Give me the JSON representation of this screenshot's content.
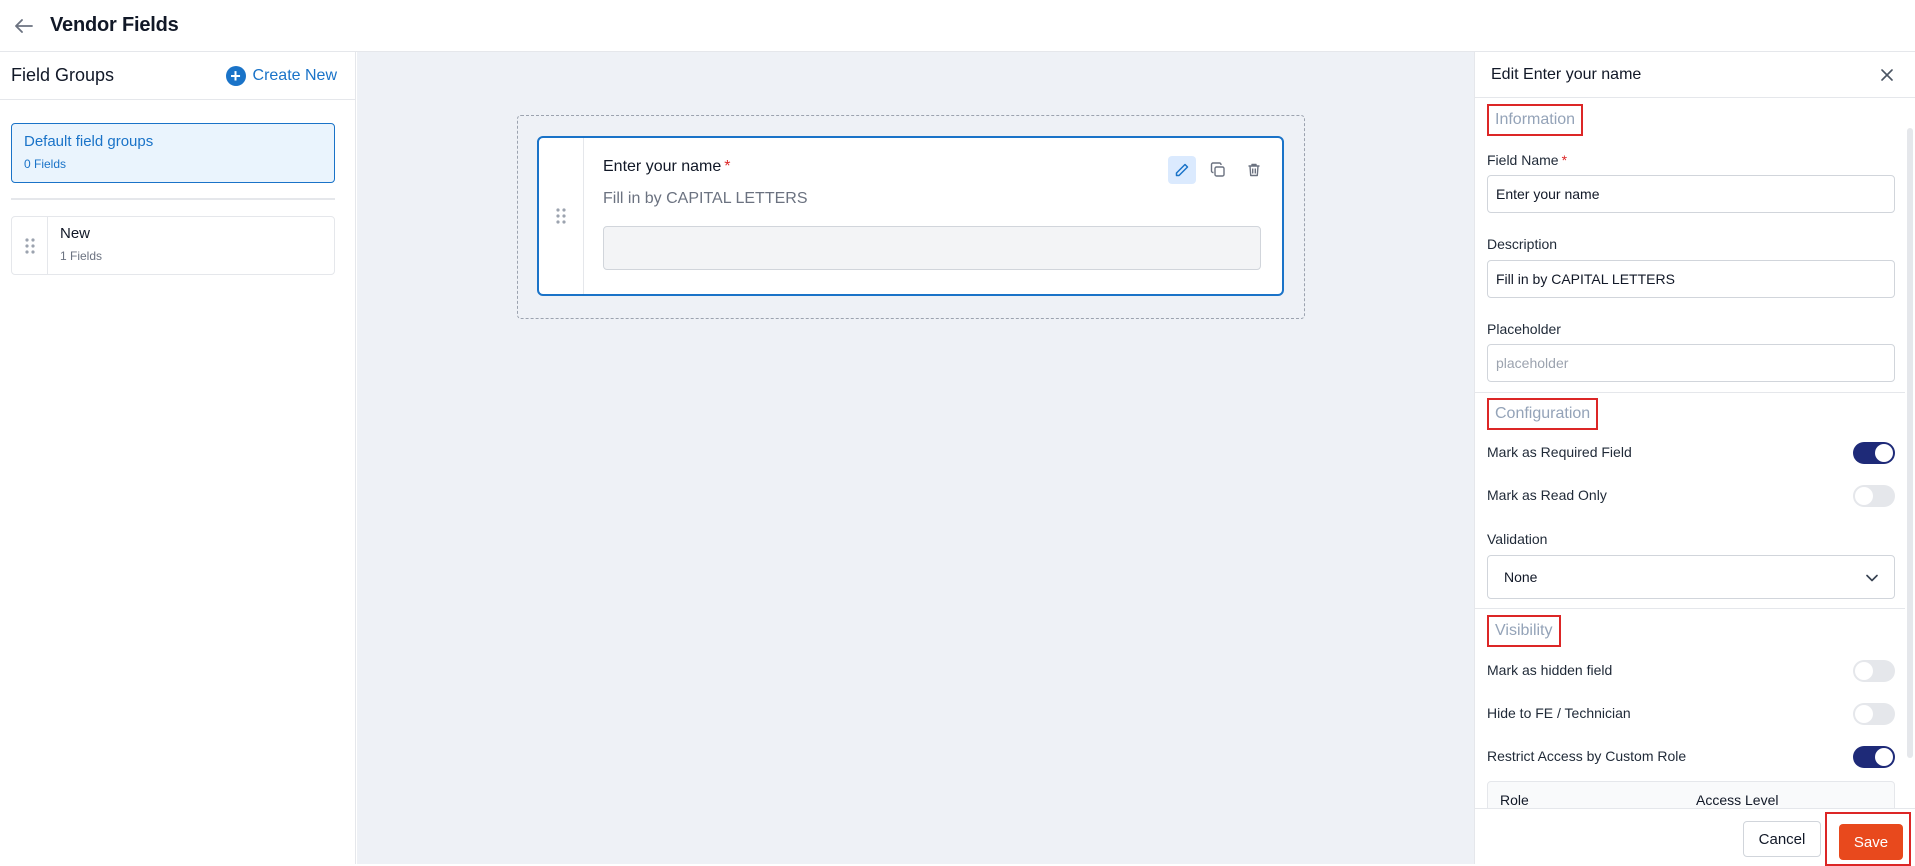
{
  "header": {
    "title": "Vendor Fields",
    "back_icon": "arrow-left-icon"
  },
  "sidebar": {
    "title": "Field Groups",
    "create_new_label": "Create New",
    "groups": [
      {
        "name": "Default field groups",
        "count": "0 Fields",
        "selected": true
      },
      {
        "name": "New",
        "count": "1 Fields",
        "selected": false
      }
    ]
  },
  "canvas": {
    "field": {
      "label": "Enter your name",
      "required_marker": "*",
      "description": "Fill in by CAPITAL LETTERS",
      "actions": [
        "edit-icon",
        "copy-icon",
        "trash-icon"
      ]
    }
  },
  "panel": {
    "title": "Edit Enter your name",
    "information": {
      "title": "Information",
      "field_name_label": "Field Name",
      "required_marker": "*",
      "field_name_value": "Enter your name",
      "description_label": "Description",
      "description_value": "Fill in by CAPITAL LETTERS",
      "placeholder_label": "Placeholder",
      "placeholder_placeholder": "placeholder"
    },
    "configuration": {
      "title": "Configuration",
      "required_label": "Mark as Required Field",
      "required_on": true,
      "readonly_label": "Mark as Read Only",
      "readonly_on": false,
      "validation_label": "Validation",
      "validation_value": "None"
    },
    "visibility": {
      "title": "Visibility",
      "hidden_label": "Mark as hidden field",
      "hidden_on": false,
      "hide_fe_label": "Hide to FE / Technician",
      "hide_fe_on": false,
      "restrict_label": "Restrict Access by Custom Role",
      "restrict_on": true,
      "table_headers": [
        "Role",
        "Access Level"
      ]
    },
    "footer": {
      "cancel_label": "Cancel",
      "save_label": "Save"
    }
  },
  "colors": {
    "accent": "#1a73c8",
    "toggle_on": "#1e2a78",
    "save_button": "#e8491d",
    "highlight_box": "#dc2626"
  }
}
